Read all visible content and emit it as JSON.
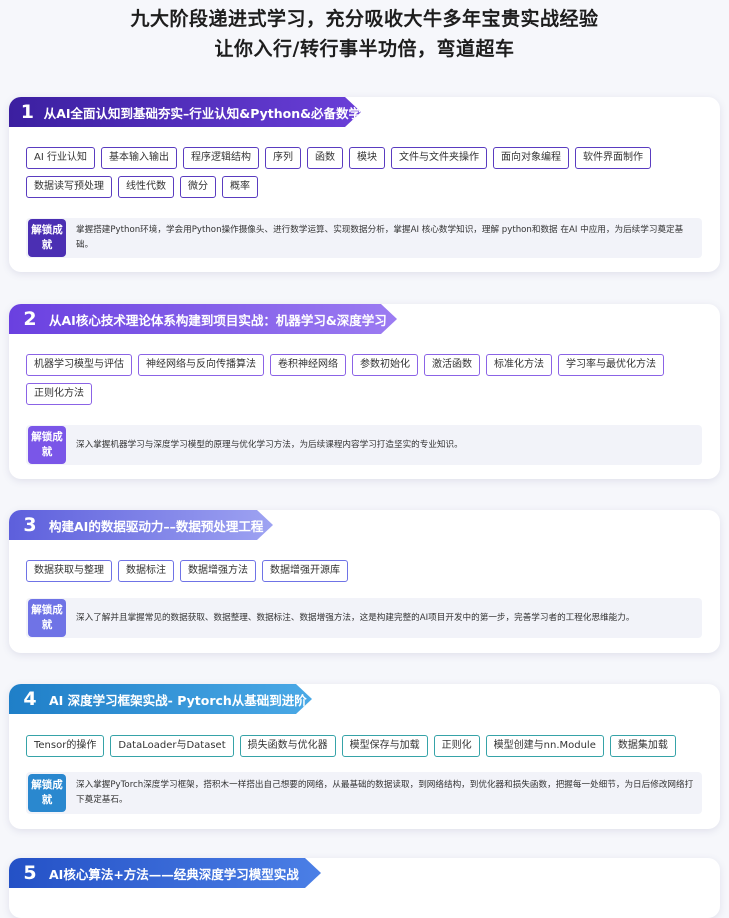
{
  "header": {
    "line1": "九大阶段递进式学习，充分吸收大牛多年宝贵实战经验",
    "line2": "让你入行/转行事半功倍，弯道超车"
  },
  "colors": {
    "stage1": "#4b2fb3",
    "stage2": "#7a56e8",
    "stage3": "#6f73e6",
    "stage4": "#2a88cf",
    "stage5": "#2f5fd0"
  },
  "achievement_label": "解锁成就",
  "stages": [
    {
      "number": "1",
      "title": "从AI全面认知到基础夯实–行业认知&Python&必备数学",
      "tags": [
        "AI 行业认知",
        "基本输入输出",
        "程序逻辑结构",
        "序列",
        "函数",
        "模块",
        "文件与文件夹操作",
        "面向对象编程",
        "软件界面制作",
        "数据读写预处理",
        "线性代数",
        "微分",
        "概率"
      ],
      "achievement": "掌握搭建Python环境，学会用Python操作摄像头、进行数学运算、实现数据分析，掌握AI 核心数学知识，理解 python和数据 在AI 中应用，为后续学习奠定基础。"
    },
    {
      "number": "2",
      "title": "从AI核心技术理论体系构建到项目实战：机器学习&深度学习",
      "tags": [
        "机器学习模型与评估",
        "神经网络与反向传播算法",
        "卷积神经网络",
        "参数初始化",
        "激活函数",
        "标准化方法",
        "学习率与最优化方法",
        "正则化方法"
      ],
      "achievement": "深入掌握机器学习与深度学习模型的原理与优化学习方法，为后续课程内容学习打造坚实的专业知识。"
    },
    {
      "number": "3",
      "title": "构建AI的数据驱动力––数据预处理工程",
      "tags": [
        "数据获取与整理",
        "数据标注",
        "数据增强方法",
        "数据增强开源库"
      ],
      "achievement": "深入了解并且掌握常见的数据获取、数据整理、数据标注、数据增强方法，这是构建完整的AI项目开发中的第一步，完善学习者的工程化思维能力。"
    },
    {
      "number": "4",
      "title": "AI 深度学习框架实战- Pytorch从基础到进阶",
      "tags": [
        "Tensor的操作",
        "DataLoader与Dataset",
        "损失函数与优化器",
        "模型保存与加载",
        "正则化",
        "模型创建与nn.Module",
        "数据集加载"
      ],
      "achievement": "深入掌握PyTorch深度学习框架，搭积木一样搭出自己想要的网络，从最基础的数据读取，到网络结构，到优化器和损失函数，把握每一处细节，为日后修改网络打下奠定基石。"
    },
    {
      "number": "5",
      "title": "AI核心算法+方法——经典深度学习模型实战",
      "tags": [],
      "achievement": ""
    }
  ]
}
